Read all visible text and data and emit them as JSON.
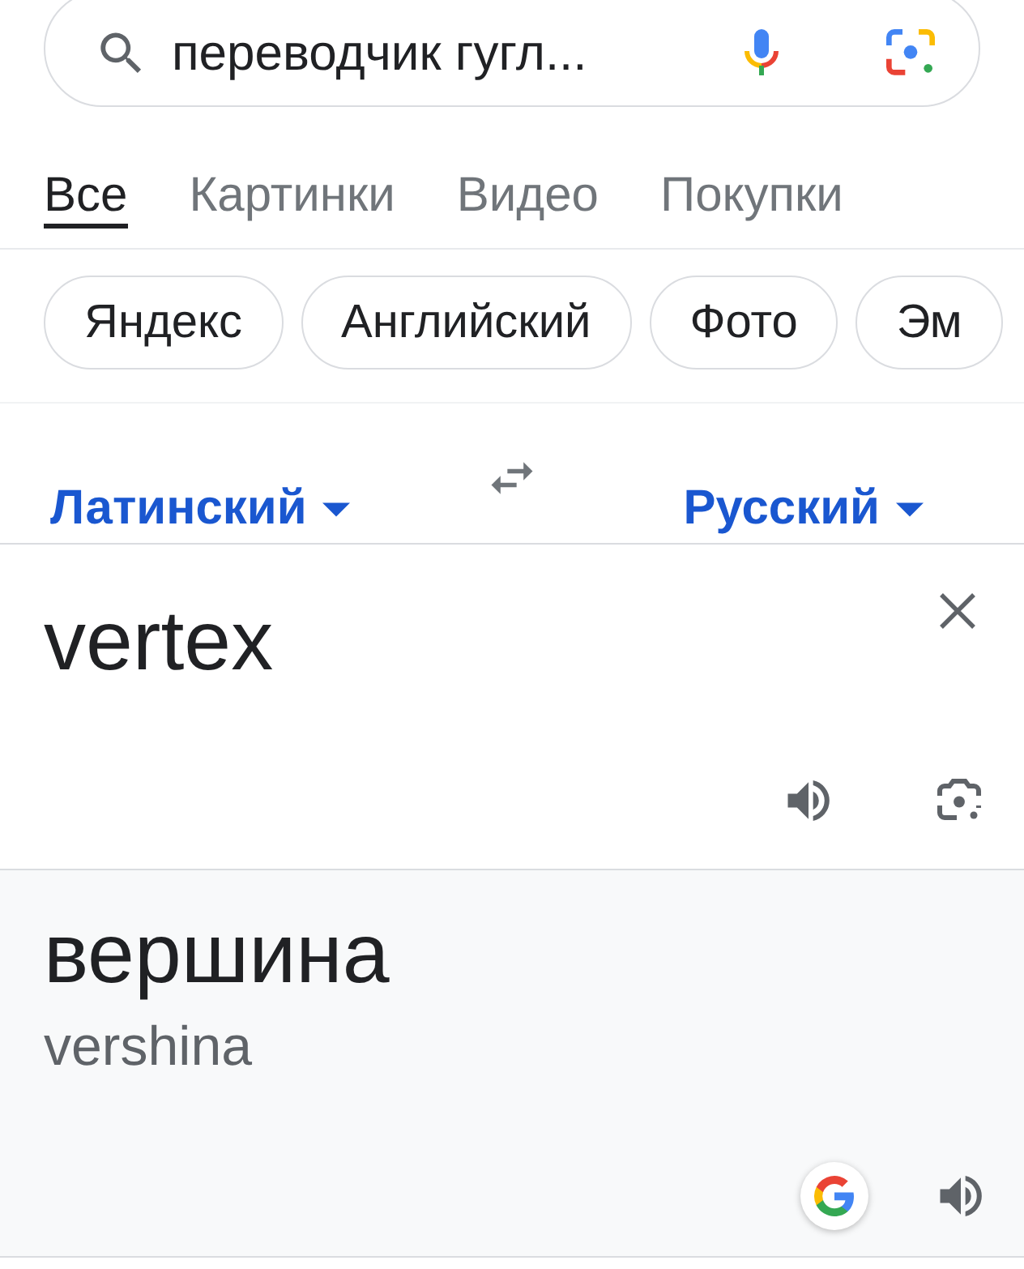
{
  "search": {
    "value": "переводчик гугл..."
  },
  "tabs": [
    {
      "label": "Все",
      "selected": true
    },
    {
      "label": "Картинки",
      "selected": false
    },
    {
      "label": "Видео",
      "selected": false
    },
    {
      "label": "Покупки",
      "selected": false
    }
  ],
  "chips": [
    "Яндекс",
    "Английский",
    "Фото",
    "Эм"
  ],
  "translator": {
    "source_language": "Латинский",
    "target_language": "Русский",
    "input": "vertex",
    "translation": "вершина",
    "transliteration": "vershina"
  }
}
